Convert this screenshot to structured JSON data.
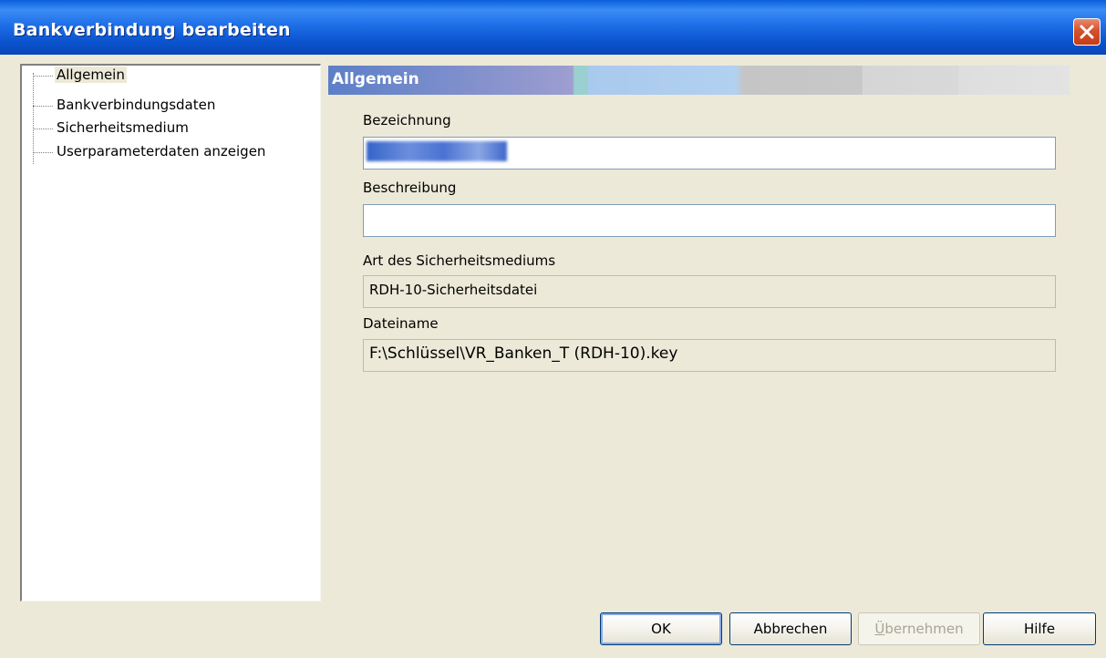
{
  "window": {
    "title": "Bankverbindung bearbeiten",
    "close_icon": "close-icon"
  },
  "tree": {
    "items": [
      {
        "label": "Allgemein",
        "selected": true
      },
      {
        "label": "Bankverbindungsdaten",
        "selected": false
      },
      {
        "label": "Sicherheitsmedium",
        "selected": false
      },
      {
        "label": "Userparameterdaten anzeigen",
        "selected": false
      }
    ]
  },
  "panel": {
    "title": "Allgemein",
    "bezeichnung_label": "Bezeichnung",
    "bezeichnung_value": "",
    "beschreibung_label": "Beschreibung",
    "beschreibung_value": "",
    "medium_label": "Art des Sicherheitsmediums",
    "medium_value": "RDH-10-Sicherheitsdatei",
    "dateiname_label": "Dateiname",
    "dateiname_value": "F:\\Schlüssel\\VR_Banken_T (RDH-10).key"
  },
  "buttons": {
    "ok": "OK",
    "cancel": "Abbrechen",
    "apply_first": "Ü",
    "apply_rest": "bernehmen",
    "help": "Hilfe"
  },
  "colors": {
    "titlebar": "#0b55d0",
    "dialog_bg": "#ece9d8",
    "close_button": "#d5512e"
  }
}
